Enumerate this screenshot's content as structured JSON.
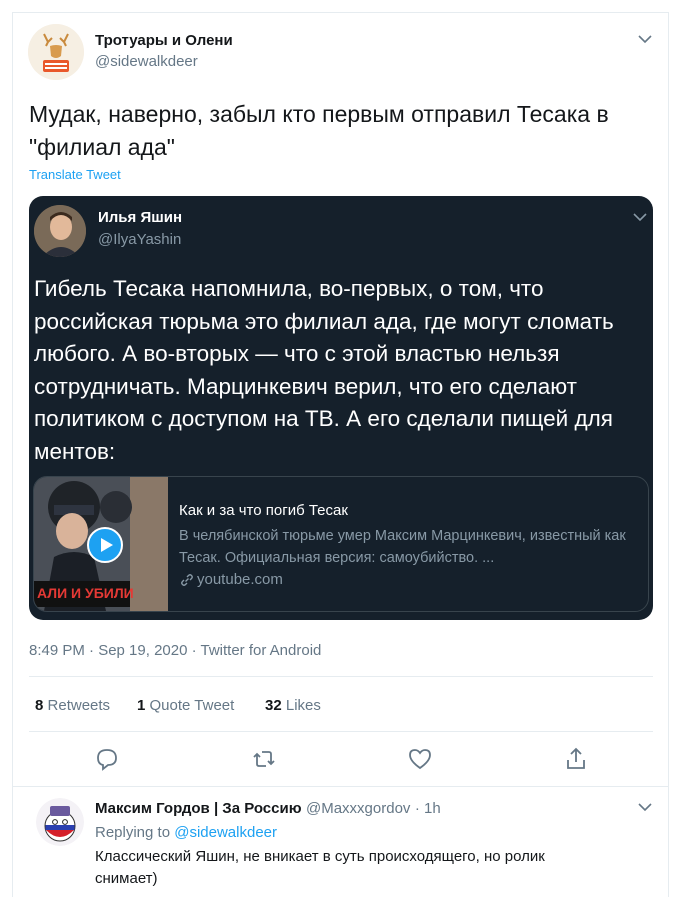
{
  "tweet": {
    "author_name": "Тротуары и Олени",
    "author_handle": "@sidewalkdeer",
    "avatar_icon": "deer-avatar-icon",
    "text": "Мудак, наверно, забыл кто первым отправил Тесака в \"филиал ада\"",
    "translate_label": "Translate Tweet",
    "timestamp": "8:49 PM · Sep 19, 2020 · Twitter for Android"
  },
  "quote": {
    "author_name": "Илья Яшин",
    "author_handle": "@IlyaYashin",
    "text": "Гибель Тесака напомнила, во-первых, о том, что российская тюрьма это филиал ада, где могут сломать любого. А во-вторых — что с этой властью нельзя сотрудничать. Марцинкевич верил, что его сделают политиком с доступом на ТВ. А его сделали пищей для ментов:",
    "card": {
      "title": "Как и за что погиб Тесак",
      "description": "В челябинской тюрьме умер Максим Марцинкевич, известный как Тесак. Официальная версия: самоубийство. ...",
      "link": "youtube.com",
      "thumb_caption": "АЛИ И УБИЛИ"
    }
  },
  "stats": {
    "retweets_count": "8",
    "retweets_label": "Retweets",
    "quotes_count": "1",
    "quotes_label": "Quote Tweet",
    "likes_count": "32",
    "likes_label": "Likes"
  },
  "actions": [
    "reply-icon",
    "retweet-icon",
    "like-icon",
    "share-icon"
  ],
  "reply": {
    "author_name": "Максим Гордов | За Россию",
    "author_handle": "@Maxxxgordov",
    "time": "· 1h",
    "replying_prefix": "Replying to",
    "replying_mention": "@sidewalkdeer",
    "text": "Классический Яшин, не вникает в суть происходящего, но ролик снимает)"
  },
  "colors": {
    "accent": "#1da1f2",
    "quote_bg": "#15202b",
    "muted": "#657786"
  }
}
